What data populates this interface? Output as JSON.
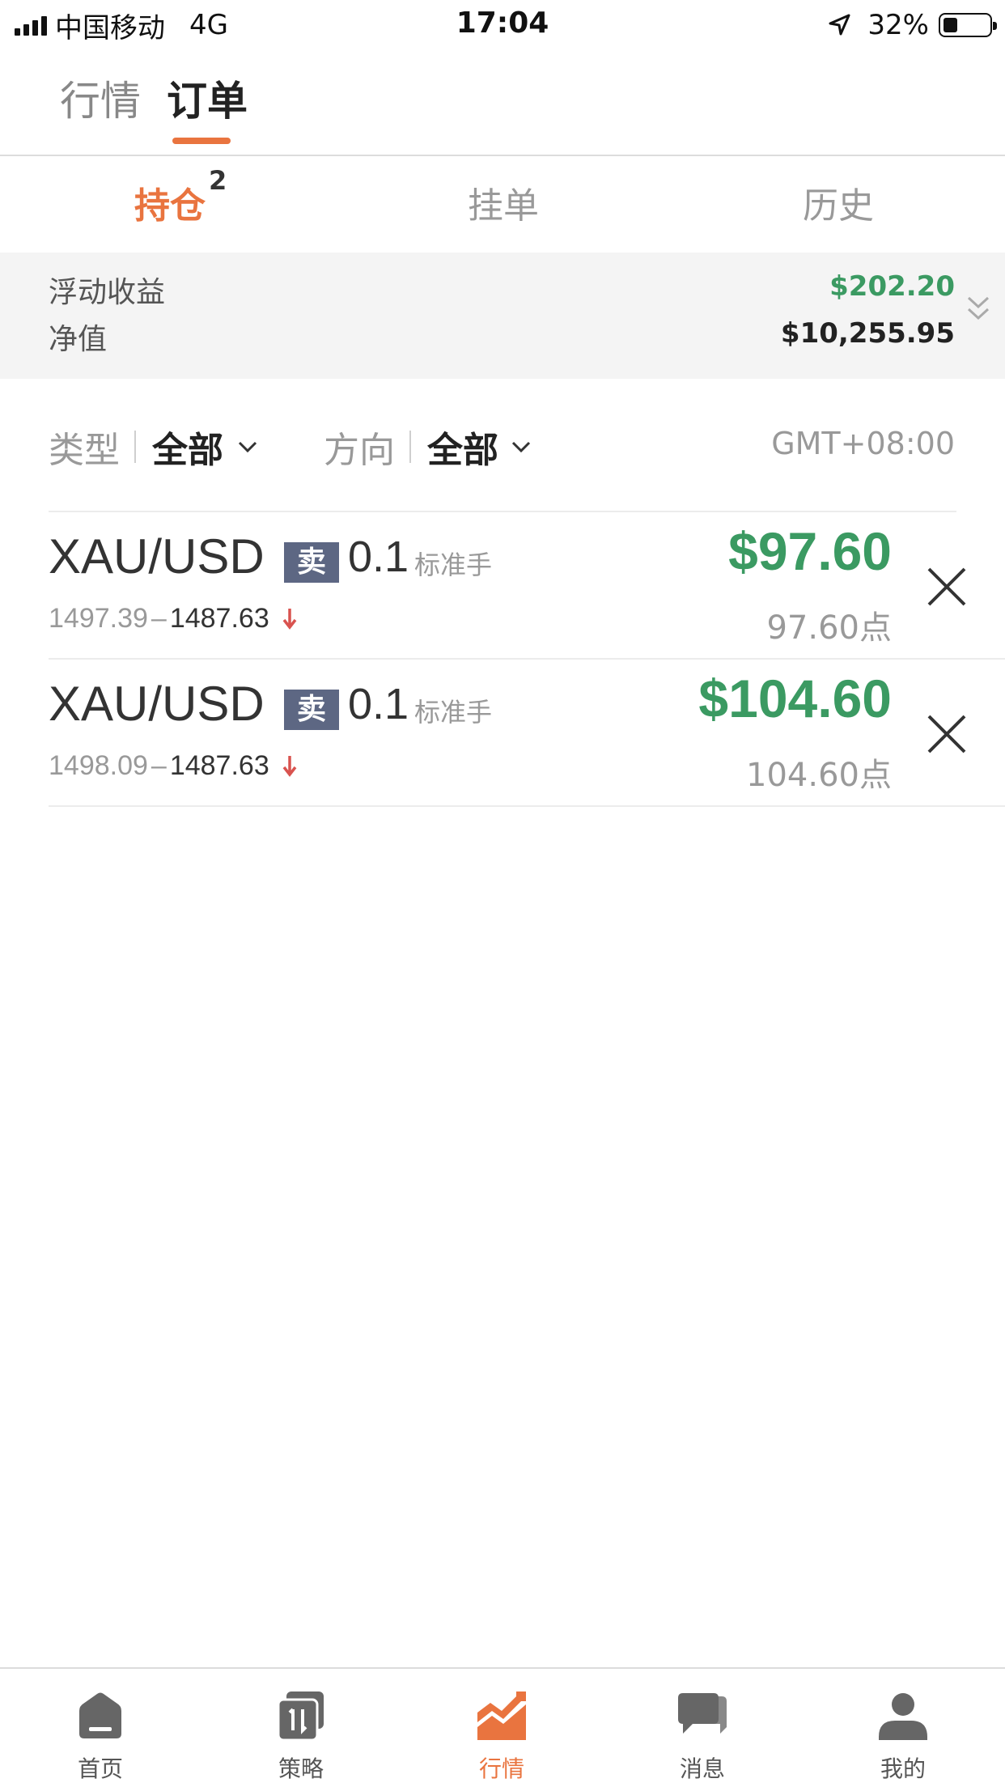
{
  "status_bar": {
    "carrier": "中国移动",
    "network": "4G",
    "time": "17:04",
    "battery": "32%",
    "battery_level": 0.32
  },
  "top_tabs": {
    "market": "行情",
    "orders": "订单",
    "active": "订单"
  },
  "sub_tabs": {
    "positions": "持仓",
    "positions_count": "2",
    "pending": "挂单",
    "history": "历史",
    "active": "持仓"
  },
  "summary": {
    "floating_pl_label": "浮动收益",
    "floating_pl_value": "$202.20",
    "equity_label": "净值",
    "equity_value": "$10,255.95"
  },
  "filters": {
    "type_label": "类型",
    "type_value": "全部",
    "direction_label": "方向",
    "direction_value": "全部",
    "timezone": "GMT+08:00"
  },
  "positions": [
    {
      "symbol": "XAU/USD",
      "side": "卖",
      "volume": "0.1",
      "lot_unit": "标准手",
      "open_price": "1497.39",
      "dash": "–",
      "current_price": "1487.63",
      "pl": "$97.60",
      "points": "97.60点"
    },
    {
      "symbol": "XAU/USD",
      "side": "卖",
      "volume": "0.1",
      "lot_unit": "标准手",
      "open_price": "1498.09",
      "dash": "–",
      "current_price": "1487.63",
      "pl": "$104.60",
      "points": "104.60点"
    }
  ],
  "bottom_nav": {
    "items": [
      {
        "label": "首页",
        "icon": "home-icon"
      },
      {
        "label": "策略",
        "icon": "strategy-icon"
      },
      {
        "label": "行情",
        "icon": "market-chart-icon"
      },
      {
        "label": "消息",
        "icon": "messages-icon"
      },
      {
        "label": "我的",
        "icon": "profile-icon"
      }
    ],
    "active": "行情"
  },
  "colors": {
    "accent": "#e9743f",
    "profit_green": "#3b9a62",
    "sell_badge": "#5d6783",
    "down_arrow": "#d9534f"
  }
}
